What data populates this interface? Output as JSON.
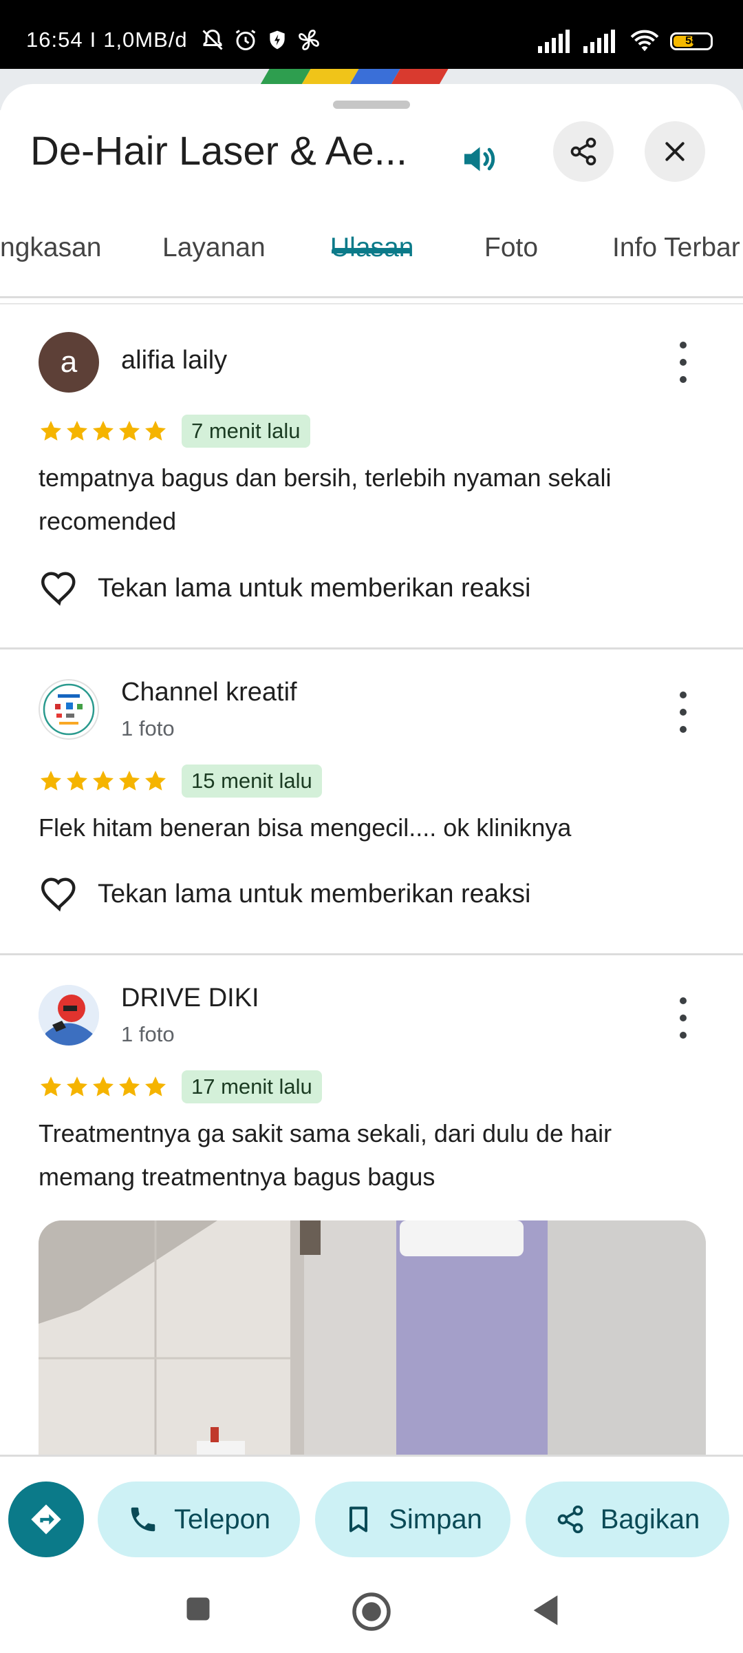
{
  "status_bar": {
    "time": "16:54",
    "separator": "I",
    "data_rate": "1,0MB/d",
    "battery": "58"
  },
  "header": {
    "title": "De-Hair Laser & Ae..."
  },
  "tabs": [
    {
      "label": "ngkasan"
    },
    {
      "label": "Layanan"
    },
    {
      "label": "Ulasan"
    },
    {
      "label": "Foto"
    },
    {
      "label": "Info Terbar"
    }
  ],
  "reviews": [
    {
      "avatar_letter": "a",
      "name": "alifia laily",
      "rating": 5,
      "time": "7 menit lalu",
      "text_line1": "tempatnya bagus dan bersih, terlebih nyaman sekali",
      "text_line2": "recomended",
      "reaction": "Tekan lama untuk memberikan reaksi"
    },
    {
      "name": "Channel kreatif",
      "sub": "1 foto",
      "rating": 5,
      "time": "15 menit lalu",
      "text_line1": "Flek hitam beneran bisa mengecil.... ok kliniknya",
      "reaction": "Tekan lama untuk memberikan reaksi"
    },
    {
      "name": "DRIVE DIKI",
      "sub": "1 foto",
      "rating": 5,
      "time": "17 menit lalu",
      "text_line1": "Treatmentnya ga sakit sama sekali, dari dulu de hair",
      "text_line2": "memang treatmentnya bagus bagus"
    }
  ],
  "actions": {
    "call": "Telepon",
    "save": "Simpan",
    "share": "Bagikan"
  },
  "colors": {
    "accent": "#0b7a89",
    "star": "#f5b400",
    "badge_bg": "#d4f0d9",
    "pill_bg": "#cdf1f5"
  }
}
